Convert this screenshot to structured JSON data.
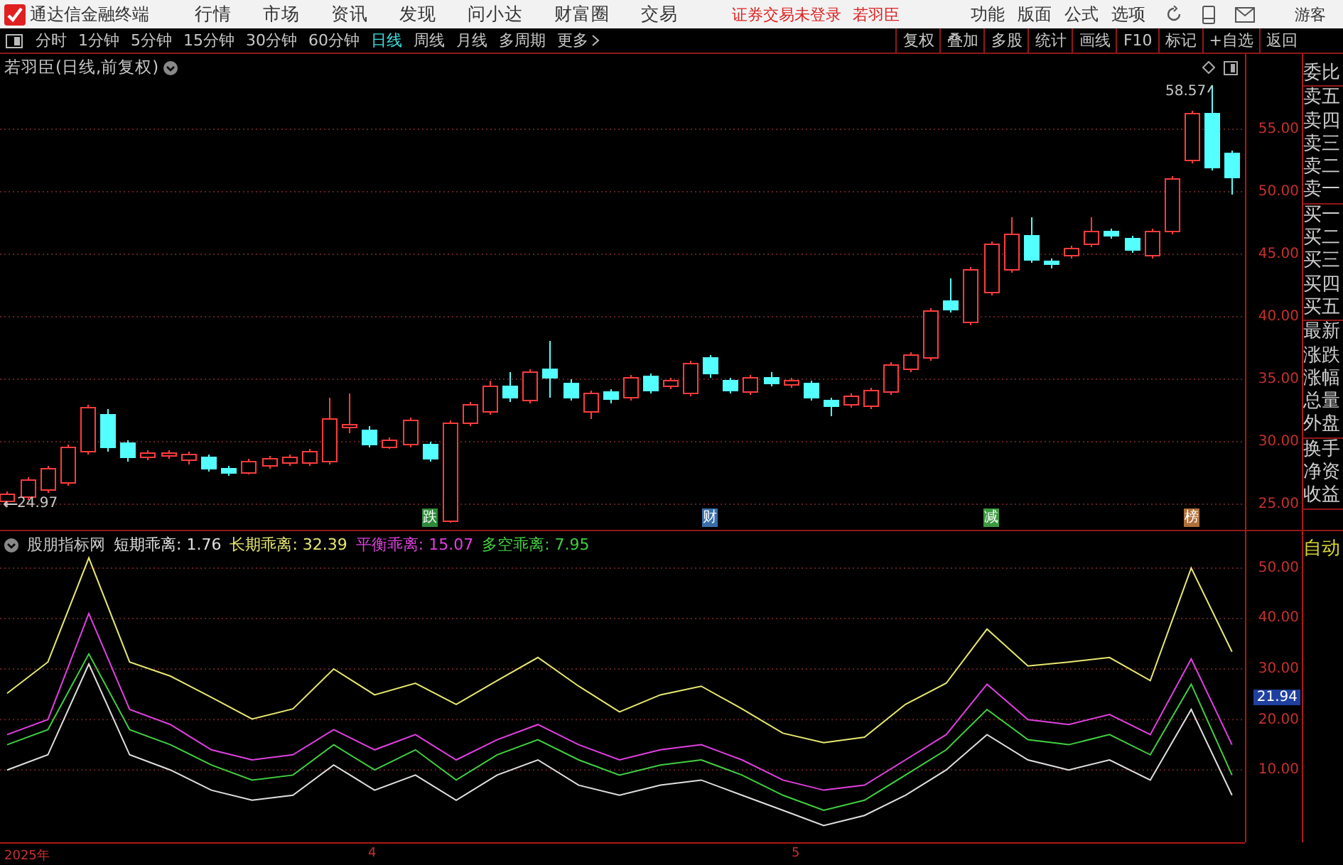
{
  "title_bar": {
    "app_name": "通达信金融终端",
    "menus": [
      "行情",
      "市场",
      "资讯",
      "发现",
      "问小达",
      "财富圈",
      "交易"
    ],
    "login_status": "证券交易未登录",
    "account": "若羽臣",
    "tools": [
      "功能",
      "版面",
      "公式",
      "选项"
    ],
    "user": "游客"
  },
  "period_bar": {
    "periods": [
      {
        "label": "分时",
        "selected": false
      },
      {
        "label": "1分钟",
        "selected": false
      },
      {
        "label": "5分钟",
        "selected": false
      },
      {
        "label": "15分钟",
        "selected": false
      },
      {
        "label": "30分钟",
        "selected": false
      },
      {
        "label": "60分钟",
        "selected": false
      },
      {
        "label": "日线",
        "selected": true
      },
      {
        "label": "周线",
        "selected": false
      },
      {
        "label": "月线",
        "selected": false
      },
      {
        "label": "多周期",
        "selected": false
      },
      {
        "label": "更多",
        "selected": false
      }
    ],
    "actions": [
      "复权",
      "叠加",
      "多股",
      "统计",
      "画线",
      "F10",
      "标记",
      "+自选",
      "返回"
    ]
  },
  "price_chart": {
    "title": "若羽臣(日线,前复权)",
    "high_label": "58.57",
    "low_label": "24.97",
    "axis_ticks": [
      "55.00",
      "50.00",
      "45.00",
      "40.00",
      "35.00",
      "30.00",
      "25.00"
    ],
    "event_tags": [
      {
        "label": "跌",
        "color": "#2e8b3a"
      },
      {
        "label": "财",
        "color": "#3a6ea8"
      },
      {
        "label": "减",
        "color": "#3c9a40"
      },
      {
        "label": "榜",
        "color": "#b0703a"
      }
    ]
  },
  "indicator": {
    "name": "股朋指标网",
    "readouts": [
      {
        "value": ": 1.76"
      },
      {
        "value": ": 32.39"
      },
      {
        "value": ": 15.07"
      },
      {
        "value": ": 7.95"
      }
    ],
    "current_value": "21.94",
    "chart_data": {
      "type": "line",
      "grid": true,
      "ylim": [
        -4.6,
        57.3
      ],
      "yticks": [
        {
          "value": 50,
          "label": "50.00"
        },
        {
          "value": 40,
          "label": "40.00"
        },
        {
          "value": 30,
          "label": "30.00"
        },
        {
          "value": 20,
          "label": "20.00"
        },
        {
          "value": 10,
          "label": "10.00"
        }
      ],
      "series": [
        {
          "name": "短期乖离",
          "color": "#e0e0e0",
          "values": [
            10,
            13,
            31,
            13,
            10,
            6,
            4,
            5,
            11,
            6,
            9,
            4,
            9,
            12,
            7,
            5,
            7,
            8,
            5,
            2,
            -1,
            1,
            5,
            10,
            17,
            12,
            10,
            12,
            8,
            22,
            5
          ]
        },
        {
          "name": "长期乖离",
          "color": "#e8e870",
          "values": [
            25.2,
            31.4,
            52,
            31.4,
            28.6,
            24.4,
            20.1,
            22.1,
            30,
            24.9,
            27.2,
            23,
            27.7,
            32.3,
            26.6,
            21.5,
            24.9,
            26.6,
            22.1,
            17.3,
            15.4,
            16.5,
            23,
            27.2,
            37.9,
            30.6,
            31.4,
            32.3,
            27.7,
            50,
            33.4
          ]
        },
        {
          "name": "平衡乖离",
          "color": "#e040e0",
          "values": [
            17,
            20,
            41,
            22,
            19,
            14,
            12,
            13,
            18,
            14,
            17,
            12,
            16,
            19,
            15,
            12,
            14,
            15,
            12,
            8,
            6,
            7,
            12,
            17,
            27,
            20,
            19,
            21,
            17,
            32,
            15
          ]
        },
        {
          "name": "多空乖离",
          "color": "#40d040",
          "values": [
            15,
            18,
            33,
            18,
            15,
            11,
            8,
            9,
            15,
            10,
            14,
            8,
            13,
            16,
            12,
            9,
            11,
            12,
            9,
            5,
            2,
            4,
            9,
            14,
            22,
            16,
            15,
            17,
            13,
            27,
            9
          ]
        }
      ]
    }
  },
  "quote_panel": {
    "groups": [
      [
        "委比"
      ],
      [
        "卖五",
        "卖四",
        "卖三",
        "卖二",
        "卖一"
      ],
      [
        "买一",
        "买二",
        "买三",
        "买四",
        "买五"
      ],
      [
        "最新",
        "涨跌",
        "涨幅",
        "总量",
        "外盘"
      ],
      [
        "换手",
        "净资",
        "收益"
      ]
    ],
    "mode": "自动"
  },
  "x_axis": {
    "labels": [
      "2025年",
      "4",
      "5"
    ]
  }
}
